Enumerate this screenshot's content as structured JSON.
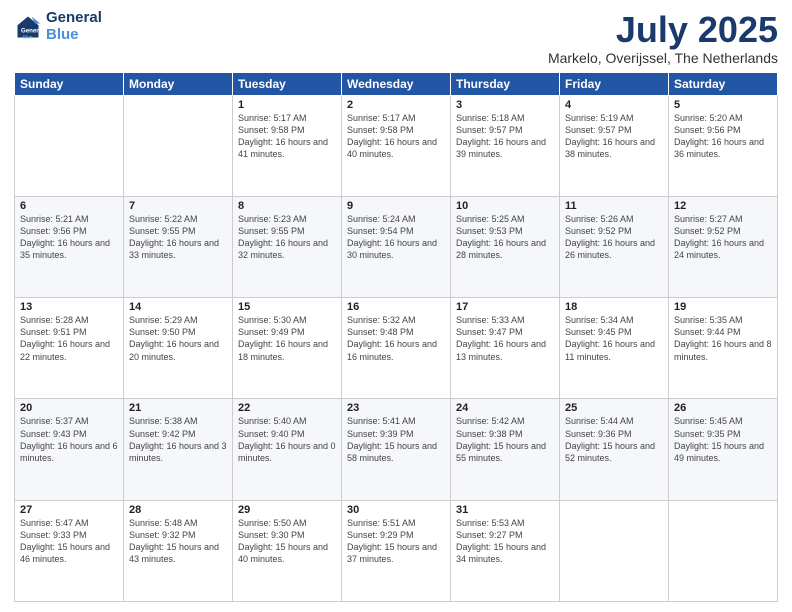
{
  "header": {
    "logo_line1": "General",
    "logo_line2": "Blue",
    "title": "July 2025",
    "subtitle": "Markelo, Overijssel, The Netherlands"
  },
  "weekdays": [
    "Sunday",
    "Monday",
    "Tuesday",
    "Wednesday",
    "Thursday",
    "Friday",
    "Saturday"
  ],
  "weeks": [
    [
      {
        "day": "",
        "sunrise": "",
        "sunset": "",
        "daylight": ""
      },
      {
        "day": "",
        "sunrise": "",
        "sunset": "",
        "daylight": ""
      },
      {
        "day": "1",
        "sunrise": "Sunrise: 5:17 AM",
        "sunset": "Sunset: 9:58 PM",
        "daylight": "Daylight: 16 hours and 41 minutes."
      },
      {
        "day": "2",
        "sunrise": "Sunrise: 5:17 AM",
        "sunset": "Sunset: 9:58 PM",
        "daylight": "Daylight: 16 hours and 40 minutes."
      },
      {
        "day": "3",
        "sunrise": "Sunrise: 5:18 AM",
        "sunset": "Sunset: 9:57 PM",
        "daylight": "Daylight: 16 hours and 39 minutes."
      },
      {
        "day": "4",
        "sunrise": "Sunrise: 5:19 AM",
        "sunset": "Sunset: 9:57 PM",
        "daylight": "Daylight: 16 hours and 38 minutes."
      },
      {
        "day": "5",
        "sunrise": "Sunrise: 5:20 AM",
        "sunset": "Sunset: 9:56 PM",
        "daylight": "Daylight: 16 hours and 36 minutes."
      }
    ],
    [
      {
        "day": "6",
        "sunrise": "Sunrise: 5:21 AM",
        "sunset": "Sunset: 9:56 PM",
        "daylight": "Daylight: 16 hours and 35 minutes."
      },
      {
        "day": "7",
        "sunrise": "Sunrise: 5:22 AM",
        "sunset": "Sunset: 9:55 PM",
        "daylight": "Daylight: 16 hours and 33 minutes."
      },
      {
        "day": "8",
        "sunrise": "Sunrise: 5:23 AM",
        "sunset": "Sunset: 9:55 PM",
        "daylight": "Daylight: 16 hours and 32 minutes."
      },
      {
        "day": "9",
        "sunrise": "Sunrise: 5:24 AM",
        "sunset": "Sunset: 9:54 PM",
        "daylight": "Daylight: 16 hours and 30 minutes."
      },
      {
        "day": "10",
        "sunrise": "Sunrise: 5:25 AM",
        "sunset": "Sunset: 9:53 PM",
        "daylight": "Daylight: 16 hours and 28 minutes."
      },
      {
        "day": "11",
        "sunrise": "Sunrise: 5:26 AM",
        "sunset": "Sunset: 9:52 PM",
        "daylight": "Daylight: 16 hours and 26 minutes."
      },
      {
        "day": "12",
        "sunrise": "Sunrise: 5:27 AM",
        "sunset": "Sunset: 9:52 PM",
        "daylight": "Daylight: 16 hours and 24 minutes."
      }
    ],
    [
      {
        "day": "13",
        "sunrise": "Sunrise: 5:28 AM",
        "sunset": "Sunset: 9:51 PM",
        "daylight": "Daylight: 16 hours and 22 minutes."
      },
      {
        "day": "14",
        "sunrise": "Sunrise: 5:29 AM",
        "sunset": "Sunset: 9:50 PM",
        "daylight": "Daylight: 16 hours and 20 minutes."
      },
      {
        "day": "15",
        "sunrise": "Sunrise: 5:30 AM",
        "sunset": "Sunset: 9:49 PM",
        "daylight": "Daylight: 16 hours and 18 minutes."
      },
      {
        "day": "16",
        "sunrise": "Sunrise: 5:32 AM",
        "sunset": "Sunset: 9:48 PM",
        "daylight": "Daylight: 16 hours and 16 minutes."
      },
      {
        "day": "17",
        "sunrise": "Sunrise: 5:33 AM",
        "sunset": "Sunset: 9:47 PM",
        "daylight": "Daylight: 16 hours and 13 minutes."
      },
      {
        "day": "18",
        "sunrise": "Sunrise: 5:34 AM",
        "sunset": "Sunset: 9:45 PM",
        "daylight": "Daylight: 16 hours and 11 minutes."
      },
      {
        "day": "19",
        "sunrise": "Sunrise: 5:35 AM",
        "sunset": "Sunset: 9:44 PM",
        "daylight": "Daylight: 16 hours and 8 minutes."
      }
    ],
    [
      {
        "day": "20",
        "sunrise": "Sunrise: 5:37 AM",
        "sunset": "Sunset: 9:43 PM",
        "daylight": "Daylight: 16 hours and 6 minutes."
      },
      {
        "day": "21",
        "sunrise": "Sunrise: 5:38 AM",
        "sunset": "Sunset: 9:42 PM",
        "daylight": "Daylight: 16 hours and 3 minutes."
      },
      {
        "day": "22",
        "sunrise": "Sunrise: 5:40 AM",
        "sunset": "Sunset: 9:40 PM",
        "daylight": "Daylight: 16 hours and 0 minutes."
      },
      {
        "day": "23",
        "sunrise": "Sunrise: 5:41 AM",
        "sunset": "Sunset: 9:39 PM",
        "daylight": "Daylight: 15 hours and 58 minutes."
      },
      {
        "day": "24",
        "sunrise": "Sunrise: 5:42 AM",
        "sunset": "Sunset: 9:38 PM",
        "daylight": "Daylight: 15 hours and 55 minutes."
      },
      {
        "day": "25",
        "sunrise": "Sunrise: 5:44 AM",
        "sunset": "Sunset: 9:36 PM",
        "daylight": "Daylight: 15 hours and 52 minutes."
      },
      {
        "day": "26",
        "sunrise": "Sunrise: 5:45 AM",
        "sunset": "Sunset: 9:35 PM",
        "daylight": "Daylight: 15 hours and 49 minutes."
      }
    ],
    [
      {
        "day": "27",
        "sunrise": "Sunrise: 5:47 AM",
        "sunset": "Sunset: 9:33 PM",
        "daylight": "Daylight: 15 hours and 46 minutes."
      },
      {
        "day": "28",
        "sunrise": "Sunrise: 5:48 AM",
        "sunset": "Sunset: 9:32 PM",
        "daylight": "Daylight: 15 hours and 43 minutes."
      },
      {
        "day": "29",
        "sunrise": "Sunrise: 5:50 AM",
        "sunset": "Sunset: 9:30 PM",
        "daylight": "Daylight: 15 hours and 40 minutes."
      },
      {
        "day": "30",
        "sunrise": "Sunrise: 5:51 AM",
        "sunset": "Sunset: 9:29 PM",
        "daylight": "Daylight: 15 hours and 37 minutes."
      },
      {
        "day": "31",
        "sunrise": "Sunrise: 5:53 AM",
        "sunset": "Sunset: 9:27 PM",
        "daylight": "Daylight: 15 hours and 34 minutes."
      },
      {
        "day": "",
        "sunrise": "",
        "sunset": "",
        "daylight": ""
      },
      {
        "day": "",
        "sunrise": "",
        "sunset": "",
        "daylight": ""
      }
    ]
  ]
}
